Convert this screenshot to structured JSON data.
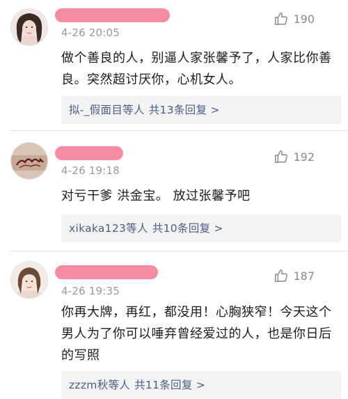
{
  "comments": [
    {
      "time": "4-26 20:05",
      "likes": "190",
      "text": "做个善良的人，别逼人家张馨予了，人家比你善良。突然超讨厌你，心机女人。",
      "reply_users": "拟-_假面目等人",
      "reply_count": "共13条回复 >",
      "avatar_icon": "user-avatar-photo"
    },
    {
      "time": "4-26 19:18",
      "likes": "192",
      "text": "对亏干爹 洪金宝。 放过张馨予吧",
      "reply_users": "xikaka123等人",
      "reply_count": "共10条回复 >",
      "avatar_icon": "user-avatar-tattoo"
    },
    {
      "time": "4-26 19:35",
      "likes": "187",
      "text": "你再大牌，再红，都没用！心胸狭窄！今天这个男人为了你可以唾弃曾经爱过的人，也是你日后的写照",
      "reply_users": "zzzm秋等人",
      "reply_count": "共11条回复 >",
      "avatar_icon": "user-avatar-photo"
    }
  ],
  "colors": {
    "name_redaction": "#f48ba3",
    "reply_link": "#4a5f85",
    "reply_bg": "#f3f3f3",
    "meta_gray": "#999999"
  },
  "icons": {
    "like": "thumbs-up-icon"
  }
}
